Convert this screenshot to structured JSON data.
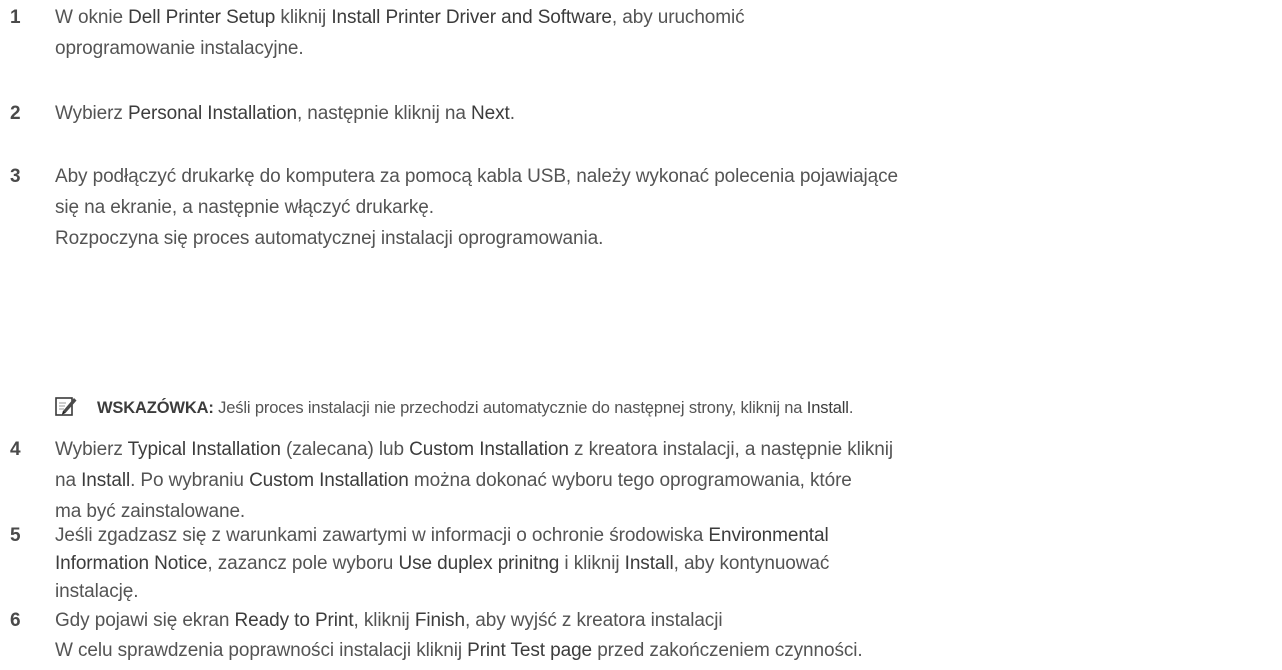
{
  "steps": [
    {
      "number": "1",
      "lines": [
        [
          {
            "t": "W oknie ",
            "b": false
          },
          {
            "t": "Dell Printer Setup",
            "b": true
          },
          {
            "t": " kliknij ",
            "b": false
          },
          {
            "t": "Install Printer Driver and Software",
            "b": true
          },
          {
            "t": ", aby uruchomić",
            "b": false
          }
        ],
        [
          {
            "t": "oprogramowanie instalacyjne.",
            "b": false
          }
        ]
      ]
    },
    {
      "number": "2",
      "lines": [
        [
          {
            "t": "Wybierz ",
            "b": false
          },
          {
            "t": "Personal Installation",
            "b": true
          },
          {
            "t": ", następnie kliknij na ",
            "b": false
          },
          {
            "t": "Next",
            "b": true
          },
          {
            "t": ".",
            "b": false
          }
        ]
      ]
    },
    {
      "number": "3",
      "lines": [
        [
          {
            "t": "Aby podłączyć drukarkę do komputera za pomocą kabla USB, należy wykonać polecenia pojawiające",
            "b": false
          }
        ],
        [
          {
            "t": "się na ekranie, a następnie włączyć drukarkę.",
            "b": false
          }
        ],
        [
          {
            "t": "Rozpoczyna się proces automatycznej instalacji oprogramowania.",
            "b": false
          }
        ]
      ]
    },
    {
      "number": "4",
      "lines": [
        [
          {
            "t": "Wybierz ",
            "b": false
          },
          {
            "t": "Typical Installation",
            "b": true
          },
          {
            "t": " (zalecana) lub ",
            "b": false
          },
          {
            "t": "Custom Installation",
            "b": true
          },
          {
            "t": " z kreatora instalacji, a następnie kliknij",
            "b": false
          }
        ],
        [
          {
            "t": "na ",
            "b": false
          },
          {
            "t": "Install",
            "b": true
          },
          {
            "t": ". Po wybraniu ",
            "b": false
          },
          {
            "t": "Custom Installation",
            "b": true
          },
          {
            "t": " można dokonać wyboru tego oprogramowania, które",
            "b": false
          }
        ],
        [
          {
            "t": "ma być zainstalowane.",
            "b": false
          }
        ]
      ]
    },
    {
      "number": "5",
      "lines": [
        [
          {
            "t": "Jeśli zgadzasz się z warunkami zawartymi w informacji o ochronie środowiska ",
            "b": false
          },
          {
            "t": "Environmental",
            "b": true
          }
        ],
        [
          {
            "t": "Information Notice",
            "b": true
          },
          {
            "t": ", zazancz pole wyboru ",
            "b": false
          },
          {
            "t": "Use duplex prinitng",
            "b": true
          },
          {
            "t": " i kliknij ",
            "b": false
          },
          {
            "t": "Install",
            "b": true
          },
          {
            "t": ", aby kontynuować",
            "b": false
          }
        ],
        [
          {
            "t": "instalację.",
            "b": false
          }
        ]
      ]
    },
    {
      "number": "6",
      "lines": [
        [
          {
            "t": "Gdy pojawi się ekran ",
            "b": false
          },
          {
            "t": "Ready to Print",
            "b": true
          },
          {
            "t": ", kliknij ",
            "b": false
          },
          {
            "t": "Finish",
            "b": true
          },
          {
            "t": ", aby wyjść z kreatora instalacji",
            "b": false
          }
        ],
        [
          {
            "t": "W celu sprawdzenia poprawności instalacji kliknij ",
            "b": false
          },
          {
            "t": "Print Test page",
            "b": true
          },
          {
            "t": " przed zakończeniem czynności.",
            "b": false
          }
        ]
      ]
    }
  ],
  "note": {
    "icon": "pencil-note-icon",
    "label": "WSKAZÓWKA:",
    "segments": [
      {
        "t": " Jeśli proces instalacji nie przechodzi automatycznie do następnej strony, kliknij na ",
        "b": false
      },
      {
        "t": "Install",
        "b": true
      },
      {
        "t": ".",
        "b": false
      }
    ]
  },
  "colors": {
    "text": "#545454",
    "emphasis": "#3c3c3c",
    "number": "#4a4a4a"
  }
}
